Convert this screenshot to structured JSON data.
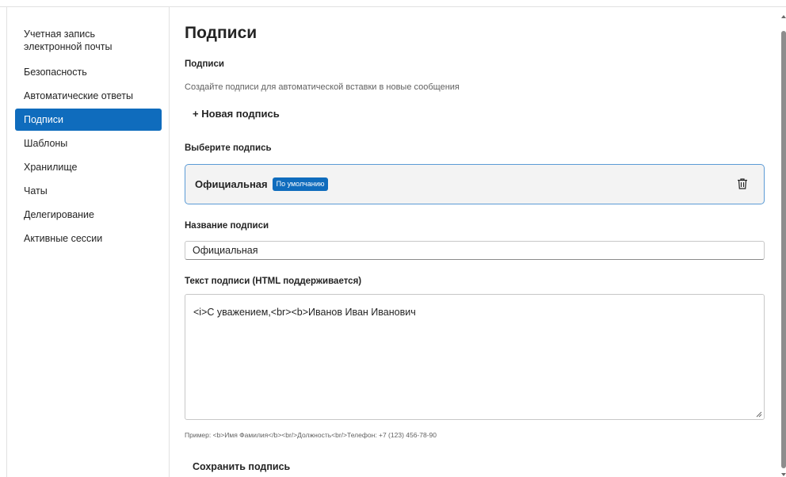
{
  "sidebar": {
    "items": [
      {
        "label": "Учетная запись электронной почты",
        "active": false
      },
      {
        "label": "Безопасность",
        "active": false
      },
      {
        "label": "Автоматические ответы",
        "active": false
      },
      {
        "label": "Подписи",
        "active": true
      },
      {
        "label": "Шаблоны",
        "active": false
      },
      {
        "label": "Хранилище",
        "active": false
      },
      {
        "label": "Чаты",
        "active": false
      },
      {
        "label": "Делегирование",
        "active": false
      },
      {
        "label": "Активные сессии",
        "active": false
      }
    ]
  },
  "main": {
    "title": "Подписи",
    "section_title": "Подписи",
    "description": "Создайте подписи для автоматической вставки в новые сообщения",
    "new_signature_label": "+ Новая подпись",
    "choose_label": "Выберите подпись",
    "signatures": [
      {
        "name": "Официальная",
        "badge": "По умолчанию"
      }
    ],
    "name_label": "Название подписи",
    "name_value": "Официальная",
    "text_label": "Текст подписи (HTML поддерживается)",
    "text_value": "<i>С уважением,<br><b>Иванов Иван Иванович",
    "hint": "Пример: <b>Имя Фамилия</b><br/>Должность<br/>Телефон: +7 (123) 456-78-90",
    "save_label": "Сохранить подпись"
  },
  "icons": {
    "delete": "trash-icon",
    "resize": "resize-handle-icon"
  },
  "colors": {
    "accent": "#0f6cbd",
    "card_border": "#5b9bd5",
    "card_bg": "#f3f3f3"
  }
}
